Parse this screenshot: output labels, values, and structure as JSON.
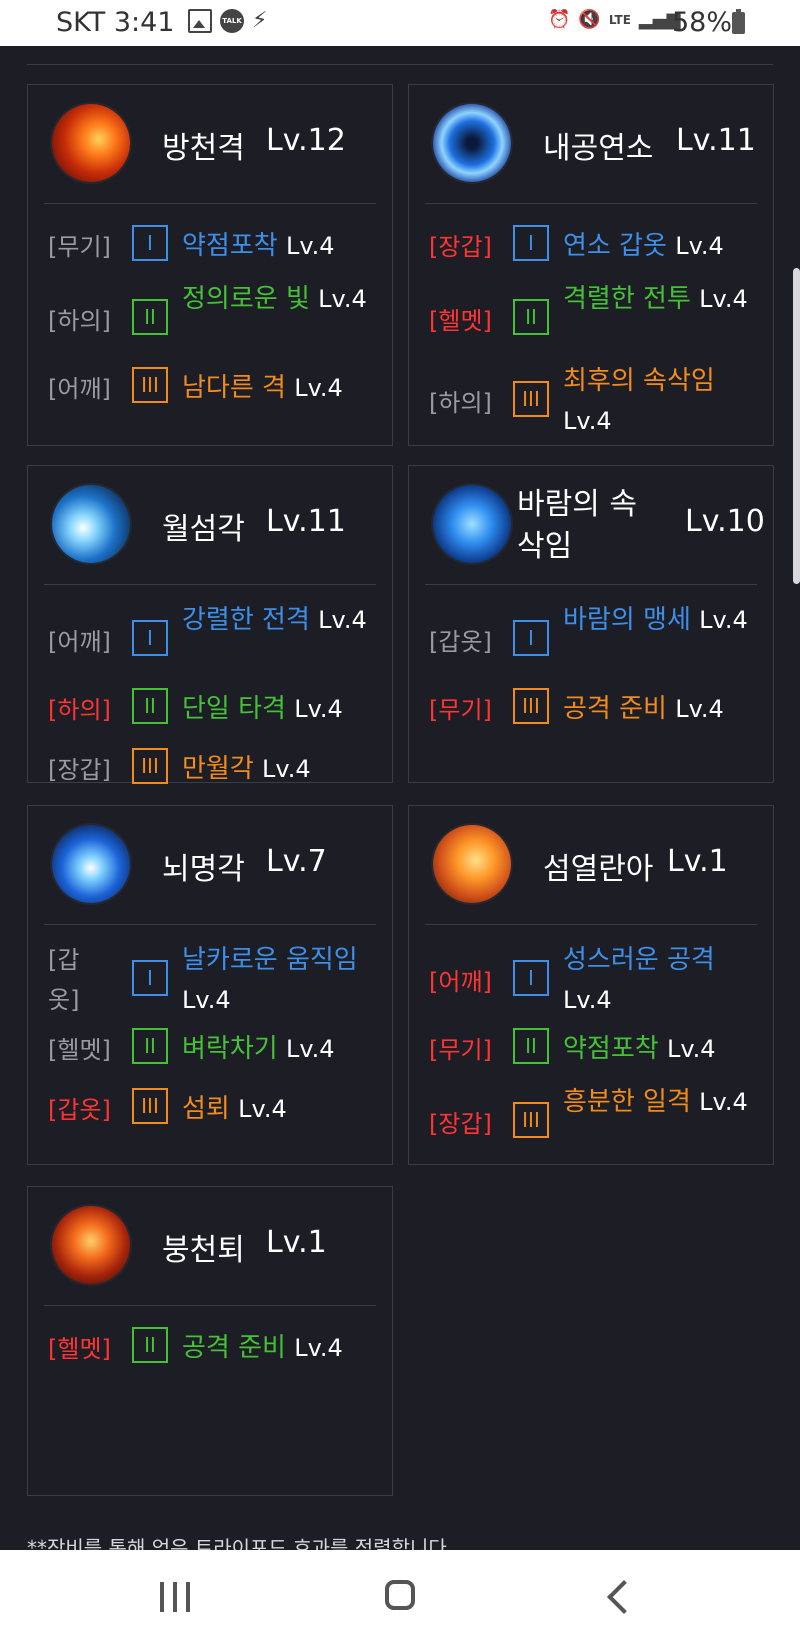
{
  "status_bar": {
    "carrier_time": "SKT 3:41",
    "battery": "58%"
  },
  "colors": {
    "background": "#1c1d25",
    "tier_1": "#3d8fe8",
    "tier_2": "#45c136",
    "tier_3": "#f08b1c",
    "slot_red": "#ff3434",
    "slot_grey": "#9a9aa2"
  },
  "skills": [
    {
      "name": "방천격",
      "level": "Lv.12",
      "icon": "flying-kick-fire-icon",
      "rows": [
        {
          "slot": "[무기]",
          "slot_color": "grey",
          "tier": "I",
          "effect": "약점포착",
          "lv": "Lv.4"
        },
        {
          "slot": "[하의]",
          "slot_color": "grey",
          "tier": "II",
          "effect": "정의로운 빛",
          "lv": "Lv.4"
        },
        {
          "slot": "[어깨]",
          "slot_color": "grey",
          "tier": "III",
          "effect": "남다른 격",
          "lv": "Lv.4"
        }
      ]
    },
    {
      "name": "내공연소",
      "level": "Lv.11",
      "icon": "blue-vortex-icon",
      "rows": [
        {
          "slot": "[장갑]",
          "slot_color": "red",
          "tier": "I",
          "effect": "연소 갑옷",
          "lv": "Lv.4"
        },
        {
          "slot": "[헬멧]",
          "slot_color": "red",
          "tier": "II",
          "effect": "격렬한 전투",
          "lv": "Lv.4"
        },
        {
          "slot": "[하의]",
          "slot_color": "grey",
          "tier": "III",
          "effect": "최후의 속삭임",
          "lv": "Lv.4"
        }
      ]
    },
    {
      "name": "월섬각",
      "level": "Lv.11",
      "icon": "crescent-slash-icon",
      "rows": [
        {
          "slot": "[어깨]",
          "slot_color": "grey",
          "tier": "I",
          "effect": "강렬한 전격",
          "lv": "Lv.4"
        },
        {
          "slot": "[하의]",
          "slot_color": "red",
          "tier": "II",
          "effect": "단일 타격",
          "lv": "Lv.4"
        },
        {
          "slot": "[장갑]",
          "slot_color": "grey",
          "tier": "III",
          "effect": "만월각",
          "lv": "Lv.4"
        }
      ]
    },
    {
      "name": "바람의 속삭임",
      "level": "Lv.10",
      "icon": "wind-runner-icon",
      "rows": [
        {
          "slot": "[갑옷]",
          "slot_color": "grey",
          "tier": "I",
          "effect": "바람의 맹세",
          "lv": "Lv.4"
        },
        {
          "slot": "[무기]",
          "slot_color": "red",
          "tier": "III",
          "effect": "공격 준비",
          "lv": "Lv.4"
        }
      ]
    },
    {
      "name": "뇌명각",
      "level": "Lv.7",
      "icon": "thunder-kick-icon",
      "rows": [
        {
          "slot": "[갑옷]",
          "slot_color": "grey",
          "tier": "I",
          "effect": "날카로운 움직임",
          "lv": "Lv.4"
        },
        {
          "slot": "[헬멧]",
          "slot_color": "grey",
          "tier": "II",
          "effect": "벼락차기",
          "lv": "Lv.4"
        },
        {
          "slot": "[갑옷]",
          "slot_color": "red",
          "tier": "III",
          "effect": "섬뢰",
          "lv": "Lv.4"
        }
      ]
    },
    {
      "name": "섬열란아",
      "level": "Lv.1",
      "icon": "fist-strike-icon",
      "rows": [
        {
          "slot": "[어깨]",
          "slot_color": "red",
          "tier": "I",
          "effect": "성스러운 공격",
          "lv": "Lv.4"
        },
        {
          "slot": "[무기]",
          "slot_color": "red",
          "tier": "II",
          "effect": "약점포착",
          "lv": "Lv.4"
        },
        {
          "slot": "[장갑]",
          "slot_color": "red",
          "tier": "III",
          "effect": "흥분한 일격",
          "lv": "Lv.4"
        }
      ]
    },
    {
      "name": "붕천퇴",
      "level": "Lv.1",
      "icon": "rising-kick-icon",
      "rows": [
        {
          "slot": "[헬멧]",
          "slot_color": "red",
          "tier": "II",
          "effect": "공격 준비",
          "lv": "Lv.4"
        }
      ]
    }
  ],
  "footnote": "**장비를 통해 얻은 트라이포드 효과를 정렬합니다"
}
